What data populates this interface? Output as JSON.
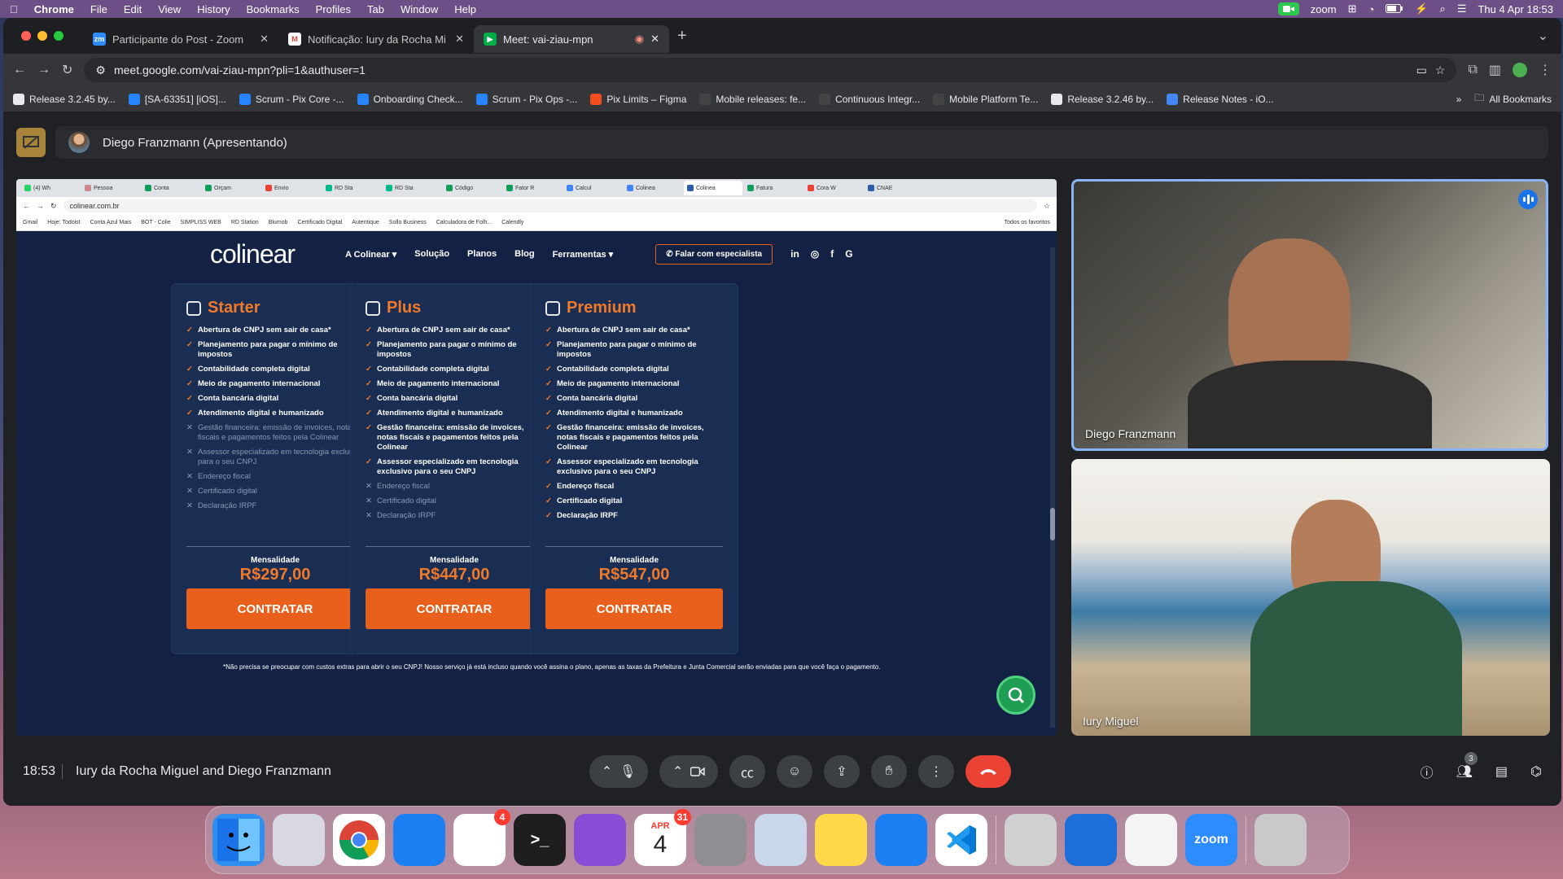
{
  "menubar": {
    "app": "Chrome",
    "items": [
      "File",
      "Edit",
      "View",
      "History",
      "Bookmarks",
      "Profiles",
      "Tab",
      "Window",
      "Help"
    ],
    "zoom_label": "zoom",
    "datetime": "Thu 4 Apr  18:53"
  },
  "tabs": [
    {
      "title": "Participante do Post - Zoom",
      "icon": "zoom-icon",
      "color": "#2d8cff",
      "active": false
    },
    {
      "title": "Notificação: Iury da Rocha Mi",
      "icon": "gmail-icon",
      "color": "#ea4335",
      "active": false
    },
    {
      "title": "Meet: vai-ziau-mpn",
      "icon": "meet-icon",
      "color": "#00ac47",
      "active": true
    }
  ],
  "url": "meet.google.com/vai-ziau-mpn?pli=1&authuser=1",
  "bookmarks": [
    {
      "label": "Release 3.2.45 by...",
      "color": "#e8eaed"
    },
    {
      "label": "[SA-63351] [iOS]...",
      "color": "#2684ff"
    },
    {
      "label": "Scrum - Pix Core -...",
      "color": "#2684ff"
    },
    {
      "label": "Onboarding Check...",
      "color": "#2684ff"
    },
    {
      "label": "Scrum - Pix Ops -...",
      "color": "#2684ff"
    },
    {
      "label": "Pix Limits – Figma",
      "color": "#f24e1e"
    },
    {
      "label": "Mobile releases: fe...",
      "color": "#444"
    },
    {
      "label": "Continuous Integr...",
      "color": "#444"
    },
    {
      "label": "Mobile Platform Te...",
      "color": "#444"
    },
    {
      "label": "Release 3.2.46 by...",
      "color": "#e8eaed"
    },
    {
      "label": "Release Notes - iO...",
      "color": "#4285f4"
    }
  ],
  "all_bookmarks": "All Bookmarks",
  "presenter": "Diego Franzmann (Apresentando)",
  "shared": {
    "tabs": [
      "(4) Wh",
      "Pessoa",
      "Conta",
      "Orçam",
      "Envio",
      "RD Sta",
      "RD Sta",
      "Código",
      "Fator R",
      "Calcul",
      "Colinea",
      "Colinea",
      "Fatura",
      "Cora W",
      "CNAE"
    ],
    "url": "colinear.com.br",
    "bookmarks": [
      "Gmail",
      "Hoje: Todoist",
      "Conta Azul Mais",
      "BOT - Colie",
      "SIMPLISS WEB",
      "RD Station",
      "Blumob",
      "Certificado Digital",
      "Autentique",
      "Sollo Business",
      "Calculadora de Folh...",
      "Calendly"
    ],
    "all_bookmarks": "Todos os favoritos",
    "site": {
      "logo": "colinear",
      "nav": [
        "A Colinear ▾",
        "Solução",
        "Planos",
        "Blog",
        "Ferramentas ▾"
      ],
      "cta": "Falar com especialista",
      "social": [
        "in",
        "◎",
        "f",
        "G"
      ],
      "plans": [
        {
          "name": "Starter",
          "features": [
            {
              "text": "Abertura de CNPJ sem sair de casa*",
              "on": true
            },
            {
              "text": "Planejamento para pagar o mínimo de impostos",
              "on": true
            },
            {
              "text": "Contabilidade completa digital",
              "on": true
            },
            {
              "text": "Meio de pagamento internacional",
              "on": true
            },
            {
              "text": "Conta bancária digital",
              "on": true
            },
            {
              "text": "Atendimento digital e humanizado",
              "on": true
            },
            {
              "text": "Gestão financeira: emissão de invoices, notas fiscais e pagamentos feitos pela Colinear",
              "on": false
            },
            {
              "text": "Assessor especializado em tecnologia exclusivo para o seu CNPJ",
              "on": false
            },
            {
              "text": "Endereço fiscal",
              "on": false
            },
            {
              "text": "Certificado digital",
              "on": false
            },
            {
              "text": "Declaração IRPF",
              "on": false
            }
          ],
          "label": "Mensalidade",
          "price": "R$297,00",
          "button": "CONTRATAR"
        },
        {
          "name": "Plus",
          "features": [
            {
              "text": "Abertura de CNPJ sem sair de casa*",
              "on": true
            },
            {
              "text": "Planejamento para pagar o mínimo de impostos",
              "on": true
            },
            {
              "text": "Contabilidade completa digital",
              "on": true
            },
            {
              "text": "Meio de pagamento internacional",
              "on": true
            },
            {
              "text": "Conta bancária digital",
              "on": true
            },
            {
              "text": "Atendimento digital e humanizado",
              "on": true
            },
            {
              "text": "Gestão financeira: emissão de invoices, notas fiscais e pagamentos feitos pela Colinear",
              "on": true
            },
            {
              "text": "Assessor especializado em tecnologia exclusivo para o seu CNPJ",
              "on": true
            },
            {
              "text": "Endereço fiscal",
              "on": false
            },
            {
              "text": "Certificado digital",
              "on": false
            },
            {
              "text": "Declaração IRPF",
              "on": false
            }
          ],
          "label": "Mensalidade",
          "price": "R$447,00",
          "button": "CONTRATAR"
        },
        {
          "name": "Premium",
          "features": [
            {
              "text": "Abertura de CNPJ sem sair de casa*",
              "on": true
            },
            {
              "text": "Planejamento para pagar o mínimo de impostos",
              "on": true
            },
            {
              "text": "Contabilidade completa digital",
              "on": true
            },
            {
              "text": "Meio de pagamento internacional",
              "on": true
            },
            {
              "text": "Conta bancária digital",
              "on": true
            },
            {
              "text": "Atendimento digital e humanizado",
              "on": true
            },
            {
              "text": "Gestão financeira: emissão de invoices, notas fiscais e pagamentos feitos pela Colinear",
              "on": true
            },
            {
              "text": "Assessor especializado em tecnologia exclusivo para o seu CNPJ",
              "on": true
            },
            {
              "text": "Endereço fiscal",
              "on": true
            },
            {
              "text": "Certificado digital",
              "on": true
            },
            {
              "text": "Declaração IRPF",
              "on": true
            }
          ],
          "label": "Mensalidade",
          "price": "R$547,00",
          "button": "CONTRATAR"
        }
      ],
      "note": "*Não precisa se preocupar com custos extras para abrir o seu CNPJ! Nosso serviço já está incluso quando você assina o plano, apenas as taxas da Prefeitura e Junta Comercial serão enviadas para que você faça o pagamento."
    }
  },
  "participants": [
    {
      "name": "Diego Franzmann"
    },
    {
      "name": "Iury Miguel"
    }
  ],
  "meeting": {
    "time": "18:53",
    "title": "Iury da Rocha Miguel and Diego Franzmann",
    "people_count": "3"
  },
  "dock": [
    {
      "name": "finder",
      "color": "#2e8ff0",
      "label": "",
      "badge": ""
    },
    {
      "name": "launchpad",
      "color": "#d8d8e0",
      "label": "",
      "badge": ""
    },
    {
      "name": "chrome",
      "color": "#ffffff",
      "label": "",
      "badge": ""
    },
    {
      "name": "xcode",
      "color": "#1c7ff2",
      "label": "",
      "badge": ""
    },
    {
      "name": "slack",
      "color": "#ffffff",
      "label": "",
      "badge": "4"
    },
    {
      "name": "terminal",
      "color": "#1e1e1e",
      "label": ">_",
      "badge": ""
    },
    {
      "name": "github-desktop",
      "color": "#8a4bd6",
      "label": "",
      "badge": ""
    },
    {
      "name": "calendar",
      "color": "#ffffff",
      "label": "4",
      "badge": "31",
      "sub": "APR"
    },
    {
      "name": "system-settings",
      "color": "#8e8e93",
      "label": "",
      "badge": ""
    },
    {
      "name": "preview",
      "color": "#c8d8ea",
      "label": "",
      "badge": ""
    },
    {
      "name": "notes",
      "color": "#ffd94a",
      "label": "",
      "badge": ""
    },
    {
      "name": "xcode-instruments",
      "color": "#1c7ff2",
      "label": "",
      "badge": ""
    },
    {
      "name": "vscode",
      "color": "#ffffff",
      "label": "",
      "badge": ""
    },
    {
      "name": "screen-recorder",
      "color": "#d0d0d0",
      "label": "",
      "badge": ""
    },
    {
      "name": "vpn",
      "color": "#1e6fd9",
      "label": "",
      "badge": ""
    },
    {
      "name": "textedit",
      "color": "#f4f4f4",
      "label": "",
      "badge": ""
    },
    {
      "name": "zoom",
      "color": "#2d8cff",
      "label": "zoom",
      "badge": ""
    },
    {
      "name": "trash",
      "color": "#c9c9c9",
      "label": "",
      "badge": ""
    }
  ]
}
